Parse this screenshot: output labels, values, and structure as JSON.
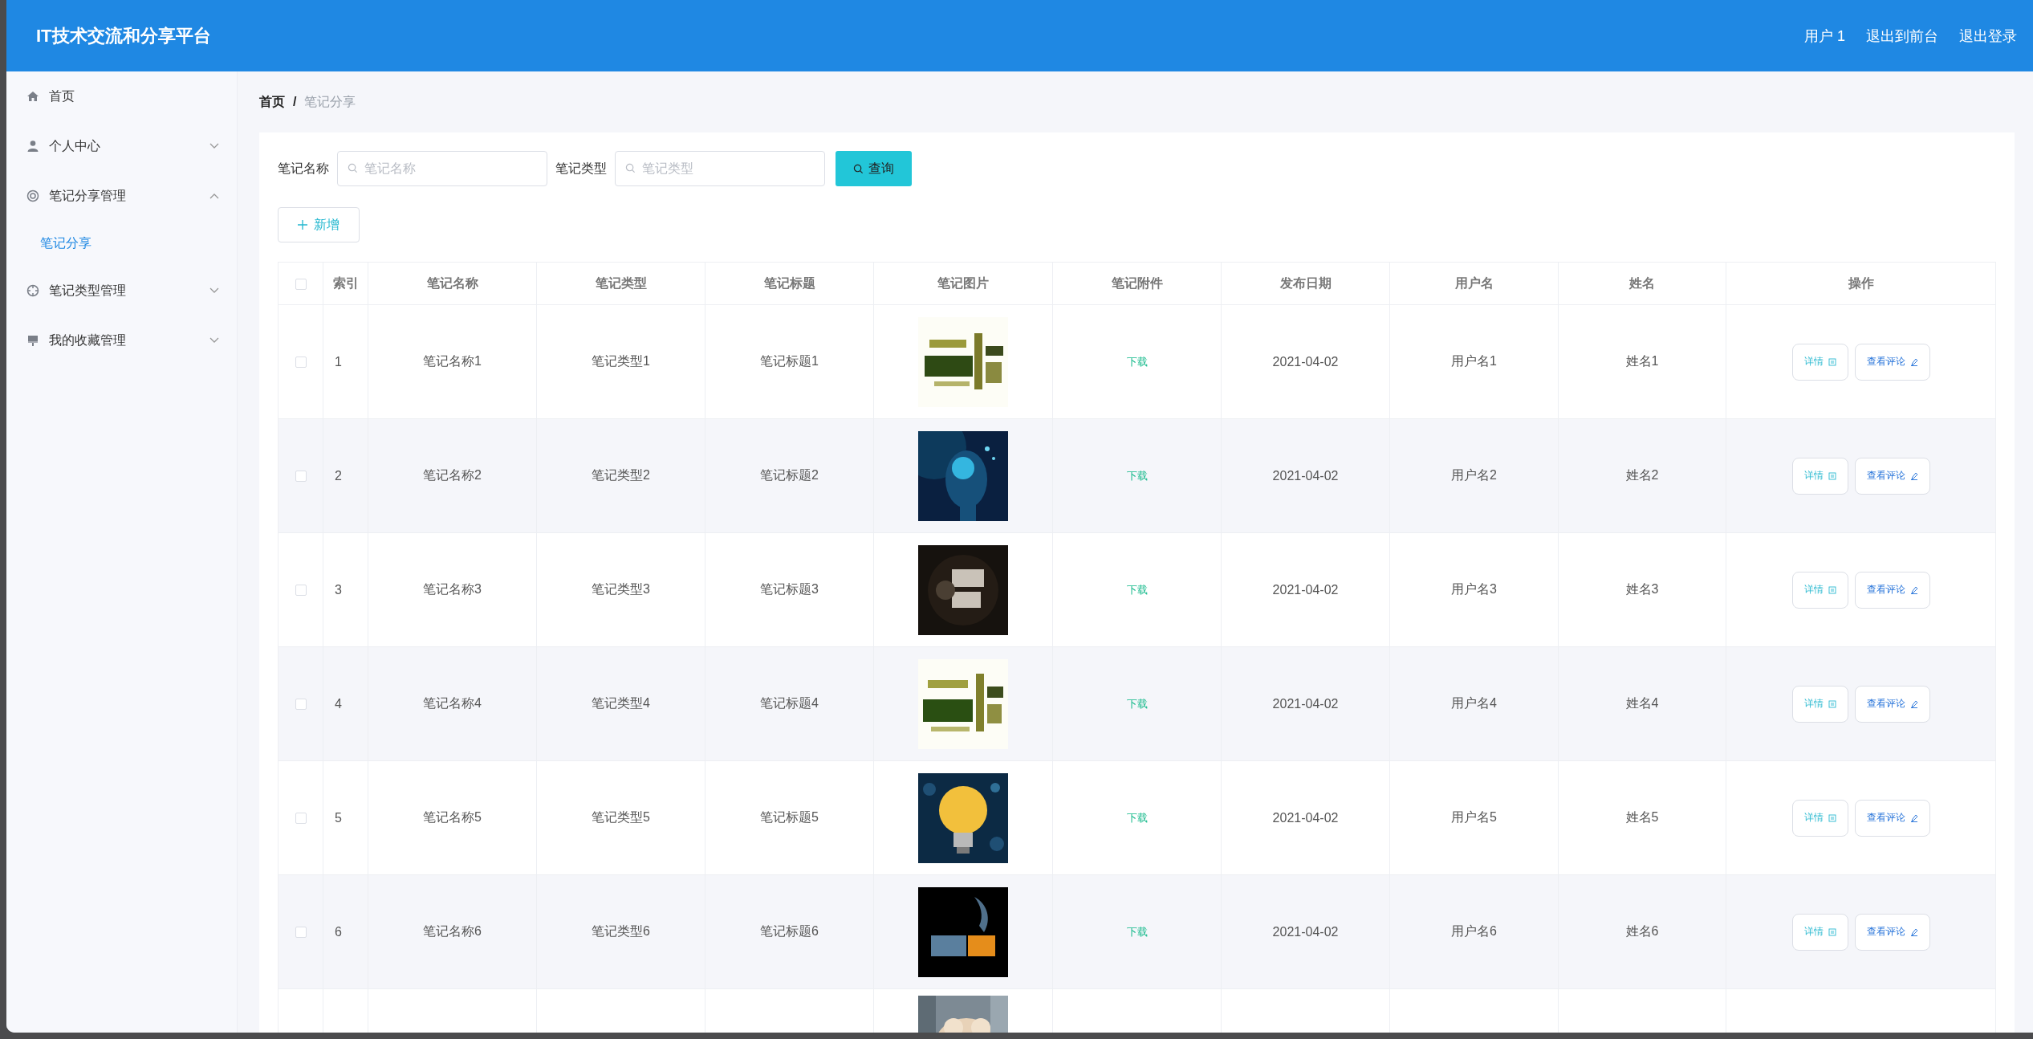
{
  "header": {
    "title": "IT技术交流和分享平台",
    "links": [
      "用户 1",
      "退出到前台",
      "退出登录"
    ]
  },
  "sidebar": {
    "items": [
      {
        "label": "首页",
        "kind": "home"
      },
      {
        "label": "个人中心",
        "kind": "person",
        "expanded": false
      },
      {
        "label": "笔记分享管理",
        "kind": "ring",
        "expanded": true,
        "children": [
          {
            "label": "笔记分享",
            "selected": true
          }
        ]
      },
      {
        "label": "笔记类型管理",
        "kind": "target",
        "expanded": false
      },
      {
        "label": "我的收藏管理",
        "kind": "pin",
        "expanded": false
      }
    ]
  },
  "breadcrumb": [
    "首页",
    "/",
    "笔记分享"
  ],
  "search": {
    "fields": [
      {
        "label": "笔记名称",
        "placeholder": "笔记名称"
      },
      {
        "label": "笔记类型",
        "placeholder": "笔记类型"
      }
    ],
    "button": "查询"
  },
  "add_button": "新增",
  "table": {
    "all_checked": false,
    "columns": [
      "索引",
      "笔记名称",
      "笔记类型",
      "笔记标题",
      "笔记图片",
      "笔记附件",
      "发布日期",
      "用户名",
      "姓名",
      "操作"
    ],
    "rows": [
      {
        "checked": false,
        "cells": [
          "1",
          "笔记名称1",
          "笔记类型1",
          "笔记标题1"
        ],
        "image": {
          "kind": "picture"
        },
        "attachment": "下载",
        "date": "2021-04-02",
        "user": "用户名1",
        "name": "姓名1",
        "actions": [
          "详情",
          "查看评论"
        ]
      },
      {
        "checked": false,
        "cells": [
          "2",
          "笔记名称2",
          "笔记类型2",
          "笔记标题2"
        ],
        "image": {
          "kind": "picture"
        },
        "attachment": "下载",
        "date": "2021-04-02",
        "user": "用户名2",
        "name": "姓名2",
        "actions": [
          "详情",
          "查看评论"
        ]
      },
      {
        "checked": false,
        "cells": [
          "3",
          "笔记名称3",
          "笔记类型3",
          "笔记标题3"
        ],
        "image": {
          "kind": "picture"
        },
        "attachment": "下载",
        "date": "2021-04-02",
        "user": "用户名3",
        "name": "姓名3",
        "actions": [
          "详情",
          "查看评论"
        ]
      },
      {
        "checked": false,
        "cells": [
          "4",
          "笔记名称4",
          "笔记类型4",
          "笔记标题4"
        ],
        "image": {
          "kind": "picture"
        },
        "attachment": "下载",
        "date": "2021-04-02",
        "user": "用户名4",
        "name": "姓名4",
        "actions": [
          "详情",
          "查看评论"
        ]
      },
      {
        "checked": false,
        "cells": [
          "5",
          "笔记名称5",
          "笔记类型5",
          "笔记标题5"
        ],
        "image": {
          "kind": "picture"
        },
        "attachment": "下载",
        "date": "2021-04-02",
        "user": "用户名5",
        "name": "姓名5",
        "actions": [
          "详情",
          "查看评论"
        ]
      },
      {
        "checked": false,
        "cells": [
          "6",
          "笔记名称6",
          "笔记类型6",
          "笔记标题6"
        ],
        "image": {
          "kind": "picture"
        },
        "attachment": "下载",
        "date": "2021-04-02",
        "user": "用户名6",
        "name": "姓名6",
        "actions": [
          "详情",
          "查看评论"
        ]
      },
      {
        "image": {
          "kind": "picture"
        }
      }
    ]
  }
}
